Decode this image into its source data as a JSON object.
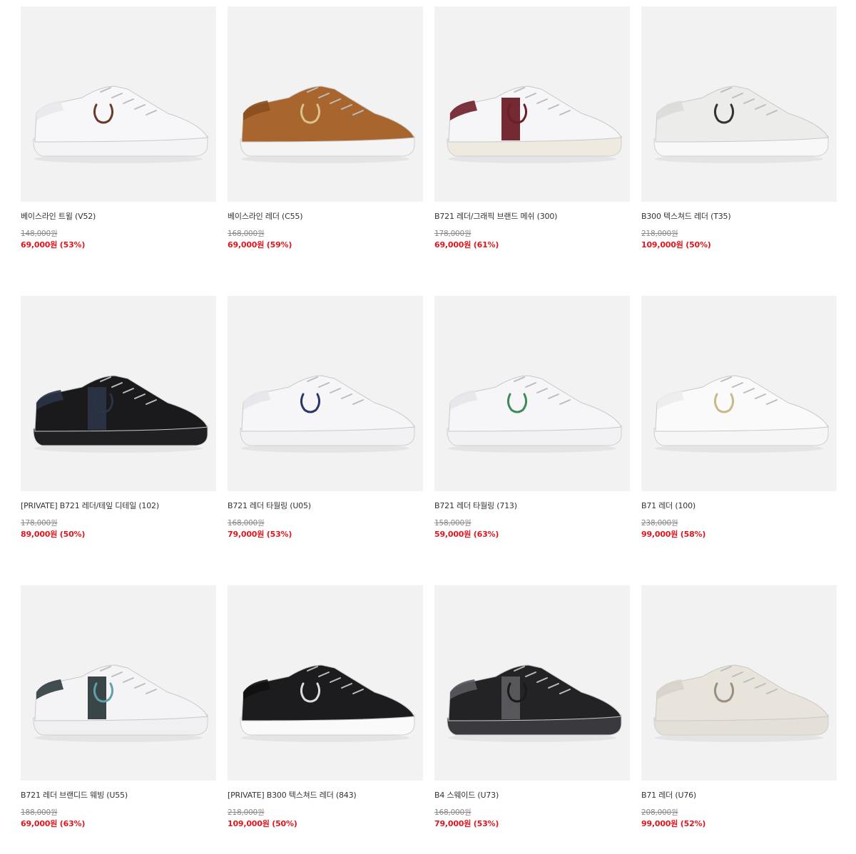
{
  "products": [
    {
      "name": "베이스라인 트윌 (V52)",
      "original_price": "148,000원",
      "sale_price": "69,000원 (53%)",
      "colors": {
        "upper": "#f7f7f9",
        "sole": "#f4f4f6",
        "accent": "#e8e8ec",
        "logo": "#6b3a2a"
      }
    },
    {
      "name": "베이스라인 레더 (C55)",
      "original_price": "168,000원",
      "sale_price": "69,000원 (59%)",
      "colors": {
        "upper": "#a8662e",
        "sole": "#f4f4f4",
        "accent": "#8a4f20",
        "logo": "#d8c38a"
      }
    },
    {
      "name": "B721 레더/그래픽 브랜드 메쉬 (300)",
      "original_price": "178,000원",
      "sale_price": "69,000원 (61%)",
      "colors": {
        "upper": "#f6f6f8",
        "sole": "#eeeae0",
        "accent": "#6e1e28",
        "logo": "#6e1e28"
      }
    },
    {
      "name": "B300 텍스쳐드 레더 (T35)",
      "original_price": "218,000원",
      "sale_price": "109,000원 (50%)",
      "colors": {
        "upper": "#ececea",
        "sole": "#f8f8f8",
        "accent": "#dcdcda",
        "logo": "#333333"
      }
    },
    {
      "name": "[PRIVATE] B721 레더/테잎 디테일 (102)",
      "original_price": "178,000원",
      "sale_price": "89,000원 (50%)",
      "colors": {
        "upper": "#1a1a1c",
        "sole": "#202022",
        "accent": "#2b3346",
        "logo": "#2b3346"
      }
    },
    {
      "name": "B721 레더 타월링 (U05)",
      "original_price": "168,000원",
      "sale_price": "79,000원 (53%)",
      "colors": {
        "upper": "#f6f6f8",
        "sole": "#f2f2f4",
        "accent": "#e6e6ea",
        "logo": "#2b3566"
      }
    },
    {
      "name": "B721 레더 타월링 (713)",
      "original_price": "158,000원",
      "sale_price": "59,000원 (63%)",
      "colors": {
        "upper": "#f6f6f8",
        "sole": "#f2f2f4",
        "accent": "#e6e6ea",
        "logo": "#3f8a5a"
      }
    },
    {
      "name": "B71 레더 (100)",
      "original_price": "238,000원",
      "sale_price": "99,000원 (58%)",
      "colors": {
        "upper": "#fafafb",
        "sole": "#f6f6f7",
        "accent": "#ececee",
        "logo": "#c9b98a"
      }
    },
    {
      "name": "B721 레더 브랜디드 웨빙 (U55)",
      "original_price": "188,000원",
      "sale_price": "69,000원 (63%)",
      "colors": {
        "upper": "#f4f4f6",
        "sole": "#f0f0f2",
        "accent": "#2f3b3d",
        "logo": "#5fa0a8"
      }
    },
    {
      "name": "[PRIVATE] B300 텍스쳐드 레더 (843)",
      "original_price": "218,000원",
      "sale_price": "109,000원 (50%)",
      "colors": {
        "upper": "#1c1c1e",
        "sole": "#fafafa",
        "accent": "#111111",
        "logo": "#dddddd"
      }
    },
    {
      "name": "B4 스웨이드 (U73)",
      "original_price": "168,000원",
      "sale_price": "79,000원 (53%)",
      "colors": {
        "upper": "#232326",
        "sole": "#3a3a3e",
        "accent": "#5a5a5e",
        "logo": "#1a1a1a"
      }
    },
    {
      "name": "B71 레더 (U76)",
      "original_price": "208,000원",
      "sale_price": "99,000원 (52%)",
      "colors": {
        "upper": "#e8e4dc",
        "sole": "#e4e0d8",
        "accent": "#d8d3ca",
        "logo": "#9a8f80"
      }
    }
  ]
}
